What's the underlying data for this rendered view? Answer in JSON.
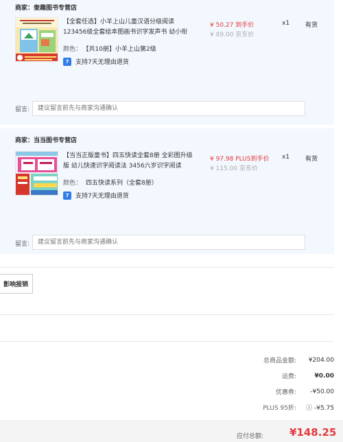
{
  "shops": [
    {
      "seller_label": "商家：",
      "seller_name": "奎趣图书专营店",
      "product": {
        "title": "【全套任选】小羊上山儿童汉语分级阅读123456级全套绘本图画书识字发声书 幼小衔",
        "spec_key": "颜色：",
        "spec_value": "【共10册】小羊上山第2级",
        "service_icon": "return-icon",
        "service": "支持7天无理由退货",
        "price": "¥ 50.27 到手价",
        "orig_price": "¥ 89.00 京东价",
        "qty": "x1",
        "stock": "有货"
      },
      "message_label": "留言:",
      "message_placeholder": "建议留言前先与商家沟通确认"
    },
    {
      "seller_label": "商家：",
      "seller_name": "当当图书专营店",
      "product": {
        "title": "【当当正版童书】四五快读全套8册 全彩图升级版 幼儿快速识字阅读法 3456六岁识字阅读",
        "spec_key": "颜色：",
        "spec_value": "四五快读系列（全套8册）",
        "service_icon": "return-icon",
        "service": "支持7天无理由退货",
        "price": "¥ 97.98 PLUS到手价",
        "orig_price": "¥ 115.00 京东价",
        "qty": "x1",
        "stock": "有货"
      },
      "message_label": "留言:",
      "message_placeholder": "建议留言前先与商家沟通确认"
    }
  ],
  "invoice_button": "影响报销",
  "summary": {
    "goods_label": "总商品金额:",
    "goods_value": "¥204.00",
    "shipping_label": "运费:",
    "shipping_value": "¥0.00",
    "coupon_label": "优惠券:",
    "coupon_value": "-¥50.00",
    "plus_label": "PLUS 95折:",
    "plus_value": "ⓘ -¥5.75",
    "total_label": "应付总额:",
    "total_value": "¥148.25"
  },
  "colors": {
    "accent": "#e4393c",
    "panel": "#f3f8fe",
    "service_icon": "#2f7ce9"
  }
}
